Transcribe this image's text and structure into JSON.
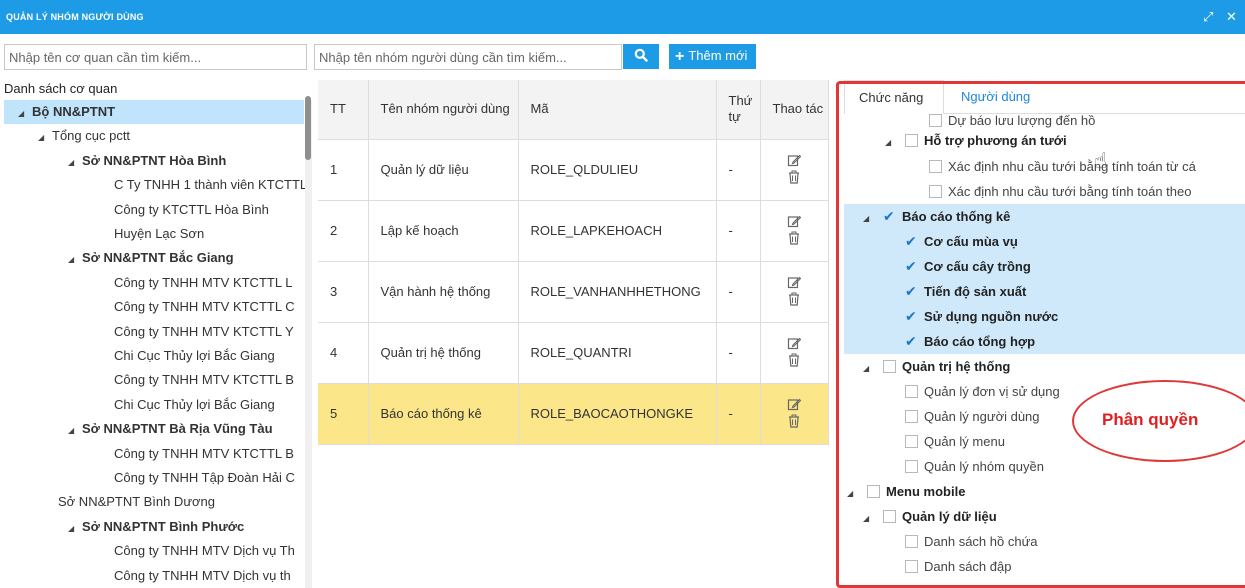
{
  "window": {
    "title": "QUẢN LÝ NHÓM NGƯỜI DÙNG",
    "restore_glyph": "⤢",
    "close_glyph": "✕"
  },
  "search": {
    "agency_placeholder": "Nhập tên cơ quan cần tìm kiếm...",
    "group_placeholder": "Nhập tên nhóm người dùng cần tìm kiếm...",
    "search_glyph": "🔍",
    "add_label": "Thêm mới"
  },
  "agency_tree": {
    "heading": "Danh sách cơ quan",
    "items": [
      {
        "label": "Bộ NN&PTNT",
        "level": 0,
        "bold": true,
        "toggle": "◢",
        "selected": true
      },
      {
        "label": "Tổng cục pctt",
        "level": 1,
        "bold": false,
        "toggle": "◢"
      },
      {
        "label": "Sở NN&PTNT Hòa Bình",
        "level": 2,
        "bold": true,
        "toggle": "◢"
      },
      {
        "label": "C Ty TNHH 1 thành viên KTCTTL",
        "level": 3
      },
      {
        "label": "Công ty KTCTTL Hòa Bình",
        "level": 3
      },
      {
        "label": "Huyện Lạc Sơn",
        "level": 3
      },
      {
        "label": "Sở NN&PTNT Bắc Giang",
        "level": 2,
        "bold": true,
        "toggle": "◢"
      },
      {
        "label": "Công ty TNHH MTV KTCTTL L",
        "level": 3
      },
      {
        "label": "Công ty TNHH MTV KTCTTL C",
        "level": 3
      },
      {
        "label": "Công ty TNHH MTV KTCTTL Y",
        "level": 3
      },
      {
        "label": "Chi Cục Thủy lợi Bắc Giang",
        "level": 3
      },
      {
        "label": "Công ty TNHH MTV KTCTTL B",
        "level": 3
      },
      {
        "label": "Chi Cục Thủy lợi Bắc Giang",
        "level": 3
      },
      {
        "label": "Sở NN&PTNT Bà Rịa Vũng Tàu",
        "level": 2,
        "bold": true,
        "toggle": "◢"
      },
      {
        "label": "Công ty TNHH MTV KTCTTL B",
        "level": 3
      },
      {
        "label": "Công ty TNHH Tập Đoàn Hải C",
        "level": 3
      },
      {
        "label": "Sở NN&PTNT Bình Dương",
        "level": 2,
        "bold": false
      },
      {
        "label": "Sở NN&PTNT Bình Phước",
        "level": 2,
        "bold": true,
        "toggle": "◢"
      },
      {
        "label": "Công ty TNHH MTV Dịch vụ Th",
        "level": 3
      },
      {
        "label": "Công ty TNHH MTV Dịch vụ th",
        "level": 3
      }
    ]
  },
  "groups_table": {
    "columns": [
      "TT",
      "Tên nhóm người dùng",
      "Mã",
      "Thứ tự",
      "Thao tác"
    ],
    "edit_glyph": "📝",
    "delete_glyph": "🗑",
    "rows": [
      {
        "tt": "1",
        "name": "Quản lý dữ liệu",
        "code": "ROLE_QLDULIEU",
        "order": "-",
        "highlight": false
      },
      {
        "tt": "2",
        "name": "Lập kế hoạch",
        "code": "ROLE_LAPKEHOACH",
        "order": "-",
        "highlight": false
      },
      {
        "tt": "3",
        "name": "Vận hành hệ thống",
        "code": "ROLE_VANHANHHETHONG",
        "order": "-",
        "highlight": false
      },
      {
        "tt": "4",
        "name": "Quản trị hệ thống",
        "code": "ROLE_QUANTRI",
        "order": "-",
        "highlight": false
      },
      {
        "tt": "5",
        "name": "Báo cáo thống kê",
        "code": "ROLE_BAOCAOTHONGKE",
        "order": "-",
        "highlight": true
      }
    ]
  },
  "permissions": {
    "tabs": [
      "Chức năng",
      "Người dùng"
    ],
    "toggle_glyph": "◢",
    "check_glyph": "✔",
    "items": [
      {
        "label": "Dự báo lưu lượng đến hồ",
        "level": 3,
        "checked": false,
        "bold": false,
        "toggle": false,
        "band": false
      },
      {
        "label": "Hỗ trợ phương án tưới",
        "level": 2,
        "checked": false,
        "bold": true,
        "toggle": true,
        "band": false
      },
      {
        "label": "Xác định nhu cầu tưới bằng tính toán từ cá",
        "level": 3,
        "checked": false,
        "bold": false,
        "toggle": false,
        "band": false
      },
      {
        "label": "Xác định nhu cầu tưới bằng tính toán theo",
        "level": 3,
        "checked": false,
        "bold": false,
        "toggle": false,
        "band": false
      },
      {
        "label": "Báo cáo thống kê",
        "level": 1,
        "checked": true,
        "bold": true,
        "toggle": true,
        "band": true
      },
      {
        "label": "Cơ cấu mùa vụ",
        "level": 2,
        "checked": true,
        "bold": true,
        "toggle": false,
        "band": true
      },
      {
        "label": "Cơ cấu cây trồng",
        "level": 2,
        "checked": true,
        "bold": true,
        "toggle": false,
        "band": true
      },
      {
        "label": "Tiến độ sản xuất",
        "level": 2,
        "checked": true,
        "bold": true,
        "toggle": false,
        "band": true
      },
      {
        "label": "Sử dụng nguồn nước",
        "level": 2,
        "checked": true,
        "bold": true,
        "toggle": false,
        "band": true
      },
      {
        "label": "Báo cáo tổng hợp",
        "level": 2,
        "checked": true,
        "bold": true,
        "toggle": false,
        "band": true
      },
      {
        "label": "Quản trị hệ thống",
        "level": 1,
        "checked": false,
        "bold": true,
        "toggle": true,
        "band": false
      },
      {
        "label": "Quản lý đơn vị sử dụng",
        "level": 2,
        "checked": false,
        "bold": false,
        "toggle": false,
        "band": false
      },
      {
        "label": "Quản lý người dùng",
        "level": 2,
        "checked": false,
        "bold": false,
        "toggle": false,
        "band": false
      },
      {
        "label": "Quản lý menu",
        "level": 2,
        "checked": false,
        "bold": false,
        "toggle": false,
        "band": false
      },
      {
        "label": "Quản lý nhóm quyền",
        "level": 2,
        "checked": false,
        "bold": false,
        "toggle": false,
        "band": false
      },
      {
        "label": "Menu mobile",
        "level": 0,
        "checked": false,
        "bold": true,
        "toggle": true,
        "band": false
      },
      {
        "label": "Quản lý dữ liệu",
        "level": 1,
        "checked": false,
        "bold": true,
        "toggle": true,
        "band": false
      },
      {
        "label": "Danh sách hồ chứa",
        "level": 2,
        "checked": false,
        "bold": false,
        "toggle": false,
        "band": false
      },
      {
        "label": "Danh sách đập",
        "level": 2,
        "checked": false,
        "bold": false,
        "toggle": false,
        "band": false
      }
    ]
  },
  "annotation": {
    "callout_label": "Phân quyền",
    "color": "#e03838"
  },
  "colors": {
    "accent": "#1e9be6",
    "selected_row": "#fbe68a",
    "checked_band": "#cfe9fb",
    "tree_selected": "#bfe4fb"
  }
}
